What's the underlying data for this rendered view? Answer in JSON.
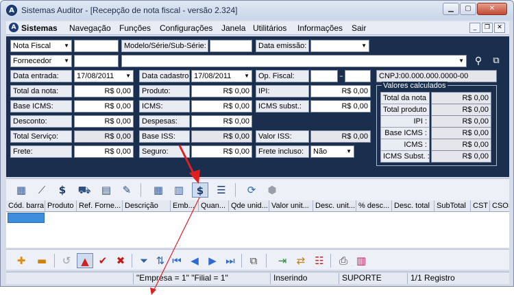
{
  "window": {
    "title": "Sistemas Auditor - [Recepção de nota fiscal - versão 2.324]",
    "app_icon_letter": "A"
  },
  "menubar": {
    "items": [
      "Sistemas",
      "Navegação",
      "Funções",
      "Configurações",
      "Janela",
      "Utilitários",
      "Informações",
      "Sair"
    ]
  },
  "form": {
    "doc_type": "Nota Fiscal",
    "doc_number": "",
    "modelo_label": "Modelo/Série/Sub-Série:",
    "modelo_value": "",
    "data_emissao_label": "Data emissão:",
    "data_emissao_value": "",
    "party_type": "Fornecedor",
    "party_code": "",
    "party_name": "",
    "data_entrada_label": "Data entrada:",
    "data_entrada_value": "17/08/2011",
    "data_cadastro_label": "Data cadastro:",
    "data_cadastro_value": "17/08/2011",
    "op_fiscal_label": "Op. Fiscal:",
    "op_fiscal_a": "",
    "op_fiscal_sep": "–",
    "op_fiscal_b": "",
    "cnpj": "CNPJ:00.000.000.0000-00",
    "total_nota_label": "Total da nota:",
    "total_nota": "R$ 0,00",
    "produto_label": "Produto:",
    "produto": "R$ 0,00",
    "ipi_label": "IPI:",
    "ipi": "R$ 0,00",
    "base_icms_label": "Base ICMS:",
    "base_icms": "R$ 0,00",
    "icms_label": "ICMS:",
    "icms": "R$ 0,00",
    "icms_subst_label": "ICMS subst.:",
    "icms_subst": "R$ 0,00",
    "desconto_label": "Desconto:",
    "desconto": "R$ 0,00",
    "despesas_label": "Despesas:",
    "despesas": "R$ 0,00",
    "total_servico_label": "Total Serviço:",
    "total_servico": "R$ 0,00",
    "base_iss_label": "Base ISS:",
    "base_iss": "R$ 0,00",
    "valor_iss_label": "Valor ISS:",
    "valor_iss": "R$ 0,00",
    "frete_label": "Frete:",
    "frete": "R$ 0,00",
    "seguro_label": "Seguro:",
    "seguro": "R$ 0,00",
    "frete_incluso_label": "Frete incluso:",
    "frete_incluso": "Não"
  },
  "calc": {
    "title": "Valores calculados",
    "rows": [
      {
        "label": "Total da nota :",
        "value": "R$ 0,00"
      },
      {
        "label": "Total produto :",
        "value": "R$ 0,00"
      },
      {
        "label": "IPI :",
        "value": "R$ 0,00"
      },
      {
        "label": "Base ICMS :",
        "value": "R$ 0,00"
      },
      {
        "label": "ICMS :",
        "value": "R$ 0,00"
      },
      {
        "label": "ICMS Subst. :",
        "value": "R$ 0,00"
      }
    ]
  },
  "grid": {
    "columns": [
      "Cód. barra",
      "Produto",
      "Ref. Forne...",
      "Descrição",
      "Emb...",
      "Quan...",
      "Qde unid...",
      "Valor unit...",
      "Desc. unit...",
      "% desc...",
      "Desc. total",
      "SubTotal",
      "CST",
      "CSOS"
    ]
  },
  "status": {
    "filter": "\"Empresa = 1\"   \"Filial = 1\"",
    "mode": "Inserindo",
    "user": "SUPORTE",
    "records": "1/1 Registro"
  },
  "colors": {
    "form_bg": "#1a2f4d",
    "selection": "#3e8edd",
    "annotation_arrow": "#e02020"
  }
}
